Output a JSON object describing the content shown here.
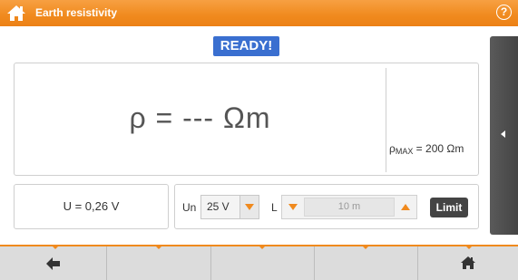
{
  "header": {
    "title": "Earth resistivity",
    "help_glyph": "?",
    "home_icon": "home-icon",
    "help_icon": "help-icon"
  },
  "status": {
    "label": "READY!"
  },
  "result": {
    "main_text": "ρ = --- Ωm",
    "max_symbol": "ρ",
    "max_sub": "MAX",
    "max_value": " = 200 Ωm"
  },
  "measurements": {
    "voltage_text": "U = 0,26 V"
  },
  "controls": {
    "un_label": "Un",
    "un_value": "25 V",
    "l_label": "L",
    "l_value": "10 m",
    "limit_label": "Limit"
  },
  "footer": {
    "buttons": [
      "back-icon",
      "",
      "",
      "",
      "home-icon"
    ]
  },
  "colors": {
    "accent": "#f08a1e",
    "badge": "#3a6fd0",
    "dark_button": "#444444"
  }
}
